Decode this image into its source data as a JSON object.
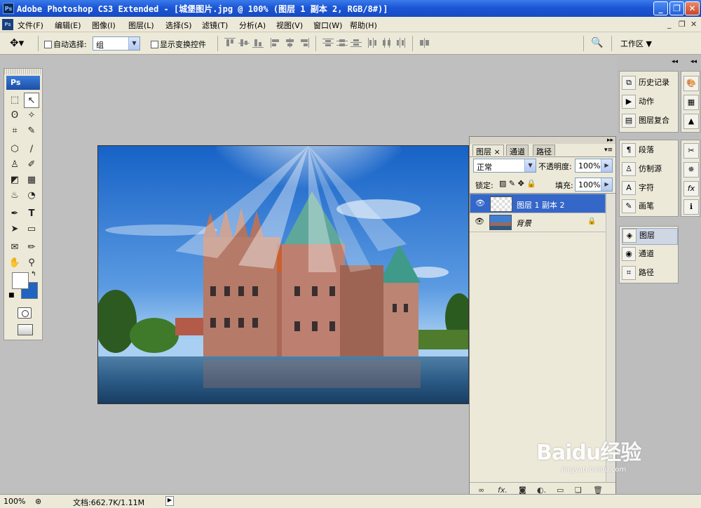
{
  "window": {
    "title": "Adobe Photoshop CS3 Extended - [城堡图片.jpg @ 100% (图层 1 副本 2, RGB/8#)]",
    "app_icon": "Ps"
  },
  "menu": {
    "items": [
      "文件(F)",
      "编辑(E)",
      "图像(I)",
      "图层(L)",
      "选择(S)",
      "滤镜(T)",
      "分析(A)",
      "视图(V)",
      "窗口(W)",
      "帮助(H)"
    ]
  },
  "options": {
    "auto_select_label": "自动选择:",
    "auto_select_value": "组",
    "show_transform_label": "显示变换控件",
    "workspace_label": "工作区"
  },
  "toolbox": {
    "logo": "Ps"
  },
  "layers_panel": {
    "tabs": [
      "图层",
      "通道",
      "路径"
    ],
    "blend_mode": "正常",
    "opacity_label": "不透明度:",
    "opacity_value": "100%",
    "lock_label": "锁定:",
    "fill_label": "填充:",
    "fill_value": "100%",
    "layers": [
      {
        "name": "图层 1 副本 2",
        "selected": true
      },
      {
        "name": "背景",
        "selected": false
      }
    ]
  },
  "dock": {
    "group1": [
      "历史记录",
      "动作",
      "图层复合"
    ],
    "group2": [
      "段落",
      "仿制源",
      "字符",
      "画笔"
    ],
    "group3": [
      "图层",
      "通道",
      "路径"
    ]
  },
  "status": {
    "zoom": "100%",
    "doc": "文档:662.7K/1.11M"
  },
  "watermark": {
    "brand": "Baidu经验",
    "sub": "jingyan.baidu.com"
  }
}
